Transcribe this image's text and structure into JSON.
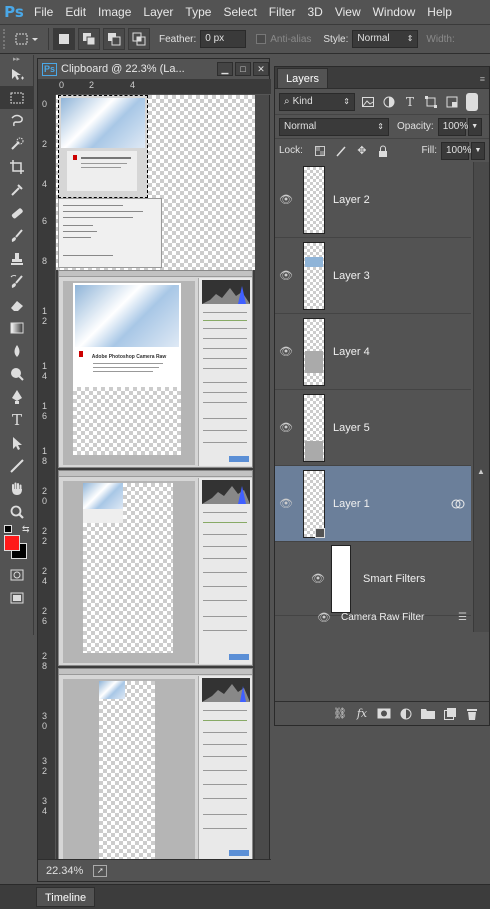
{
  "app": {
    "logo": "Ps"
  },
  "menu": [
    "File",
    "Edit",
    "Image",
    "Layer",
    "Type",
    "Select",
    "Filter",
    "3D",
    "View",
    "Window",
    "Help"
  ],
  "options": {
    "feather_label": "Feather:",
    "feather_value": "0 px",
    "antialias_label": "Anti-alias",
    "style_label": "Style:",
    "style_value": "Normal",
    "width_label": "Width:"
  },
  "tools": [
    "move-tool-icon",
    "rect-marquee-tool-icon",
    "lasso-tool-icon",
    "quick-select-tool-icon",
    "crop-tool-icon",
    "eyedropper-tool-icon",
    "healing-brush-tool-icon",
    "brush-tool-icon",
    "clone-stamp-tool-icon",
    "history-brush-tool-icon",
    "eraser-tool-icon",
    "gradient-tool-icon",
    "blur-tool-icon",
    "dodge-tool-icon",
    "pen-tool-icon",
    "type-tool-icon",
    "path-select-tool-icon",
    "line-tool-icon",
    "hand-tool-icon",
    "zoom-tool-icon"
  ],
  "colors": {
    "foreground": "#ff1a1a",
    "background": "#000000",
    "accent": "#6b7f9a"
  },
  "document": {
    "title": "Clipboard @ 22.3% (La...",
    "zoom": "22.34%",
    "ruler_top": [
      "0",
      "2",
      "4"
    ],
    "ruler_left": [
      "0",
      "2",
      "4",
      "6",
      "8",
      "1",
      "2",
      "1",
      "4",
      "1",
      "6",
      "1",
      "8",
      "2",
      "0",
      "2",
      "2",
      "2",
      "4",
      "2",
      "6",
      "2",
      "8",
      "3",
      "0",
      "3",
      "2",
      "3",
      "4"
    ],
    "shot_title": "Adobe Photoshop Camera Raw",
    "shot_subtitle": "Camera Raw Filter"
  },
  "layers_panel": {
    "tab": "Layers",
    "filter": "Kind",
    "blend_mode": "Normal",
    "opacity_label": "Opacity:",
    "opacity_value": "100%",
    "lock_label": "Lock:",
    "fill_label": "Fill:",
    "fill_value": "100%",
    "layers": [
      {
        "name": "Layer 2",
        "selected": false
      },
      {
        "name": "Layer 3",
        "selected": false
      },
      {
        "name": "Layer 4",
        "selected": false
      },
      {
        "name": "Layer 5",
        "selected": false
      },
      {
        "name": "Layer 1",
        "selected": true
      }
    ],
    "smart_filters": "Smart Filters",
    "camera_raw_filter": "Camera Raw Filter"
  },
  "timeline": {
    "tab": "Timeline"
  }
}
